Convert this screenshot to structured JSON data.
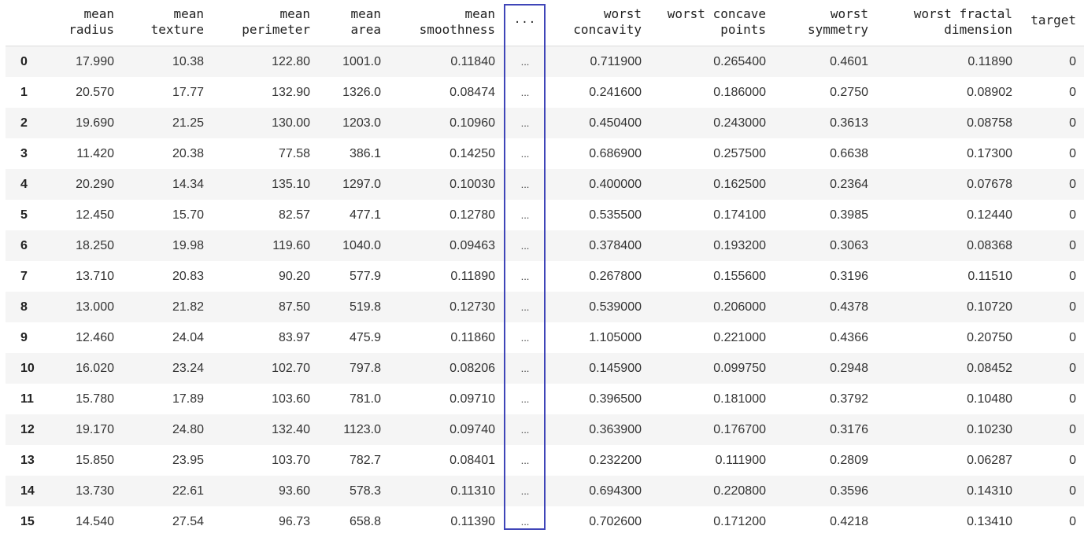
{
  "columns": [
    {
      "line1": "mean",
      "line2": "radius"
    },
    {
      "line1": "mean",
      "line2": "texture"
    },
    {
      "line1": "mean",
      "line2": "perimeter"
    },
    {
      "line1": "mean",
      "line2": "area"
    },
    {
      "line1": "mean",
      "line2": "smoothness"
    },
    {
      "line1": "...",
      "line2": ""
    },
    {
      "line1": "worst",
      "line2": "concavity"
    },
    {
      "line1": "worst concave",
      "line2": "points"
    },
    {
      "line1": "worst",
      "line2": "symmetry"
    },
    {
      "line1": "worst fractal",
      "line2": "dimension"
    },
    {
      "line1": "target",
      "line2": ""
    }
  ],
  "rows": [
    {
      "index": "0",
      "cells": [
        "17.990",
        "10.38",
        "122.80",
        "1001.0",
        "0.11840",
        "...",
        "0.711900",
        "0.265400",
        "0.4601",
        "0.11890",
        "0"
      ]
    },
    {
      "index": "1",
      "cells": [
        "20.570",
        "17.77",
        "132.90",
        "1326.0",
        "0.08474",
        "...",
        "0.241600",
        "0.186000",
        "0.2750",
        "0.08902",
        "0"
      ]
    },
    {
      "index": "2",
      "cells": [
        "19.690",
        "21.25",
        "130.00",
        "1203.0",
        "0.10960",
        "...",
        "0.450400",
        "0.243000",
        "0.3613",
        "0.08758",
        "0"
      ]
    },
    {
      "index": "3",
      "cells": [
        "11.420",
        "20.38",
        "77.58",
        "386.1",
        "0.14250",
        "...",
        "0.686900",
        "0.257500",
        "0.6638",
        "0.17300",
        "0"
      ]
    },
    {
      "index": "4",
      "cells": [
        "20.290",
        "14.34",
        "135.10",
        "1297.0",
        "0.10030",
        "...",
        "0.400000",
        "0.162500",
        "0.2364",
        "0.07678",
        "0"
      ]
    },
    {
      "index": "5",
      "cells": [
        "12.450",
        "15.70",
        "82.57",
        "477.1",
        "0.12780",
        "...",
        "0.535500",
        "0.174100",
        "0.3985",
        "0.12440",
        "0"
      ]
    },
    {
      "index": "6",
      "cells": [
        "18.250",
        "19.98",
        "119.60",
        "1040.0",
        "0.09463",
        "...",
        "0.378400",
        "0.193200",
        "0.3063",
        "0.08368",
        "0"
      ]
    },
    {
      "index": "7",
      "cells": [
        "13.710",
        "20.83",
        "90.20",
        "577.9",
        "0.11890",
        "...",
        "0.267800",
        "0.155600",
        "0.3196",
        "0.11510",
        "0"
      ]
    },
    {
      "index": "8",
      "cells": [
        "13.000",
        "21.82",
        "87.50",
        "519.8",
        "0.12730",
        "...",
        "0.539000",
        "0.206000",
        "0.4378",
        "0.10720",
        "0"
      ]
    },
    {
      "index": "9",
      "cells": [
        "12.460",
        "24.04",
        "83.97",
        "475.9",
        "0.11860",
        "...",
        "1.105000",
        "0.221000",
        "0.4366",
        "0.20750",
        "0"
      ]
    },
    {
      "index": "10",
      "cells": [
        "16.020",
        "23.24",
        "102.70",
        "797.8",
        "0.08206",
        "...",
        "0.145900",
        "0.099750",
        "0.2948",
        "0.08452",
        "0"
      ]
    },
    {
      "index": "11",
      "cells": [
        "15.780",
        "17.89",
        "103.60",
        "781.0",
        "0.09710",
        "...",
        "0.396500",
        "0.181000",
        "0.3792",
        "0.10480",
        "0"
      ]
    },
    {
      "index": "12",
      "cells": [
        "19.170",
        "24.80",
        "132.40",
        "1123.0",
        "0.09740",
        "...",
        "0.363900",
        "0.176700",
        "0.3176",
        "0.10230",
        "0"
      ]
    },
    {
      "index": "13",
      "cells": [
        "15.850",
        "23.95",
        "103.70",
        "782.7",
        "0.08401",
        "...",
        "0.232200",
        "0.111900",
        "0.2809",
        "0.06287",
        "0"
      ]
    },
    {
      "index": "14",
      "cells": [
        "13.730",
        "22.61",
        "93.60",
        "578.3",
        "0.11310",
        "...",
        "0.694300",
        "0.220800",
        "0.3596",
        "0.14310",
        "0"
      ]
    },
    {
      "index": "15",
      "cells": [
        "14.540",
        "27.54",
        "96.73",
        "658.8",
        "0.11390",
        "...",
        "0.702600",
        "0.171200",
        "0.4218",
        "0.13410",
        "0"
      ]
    }
  ],
  "highlight_color": "#3f45b8",
  "row_stripe_color": "#f5f5f5"
}
